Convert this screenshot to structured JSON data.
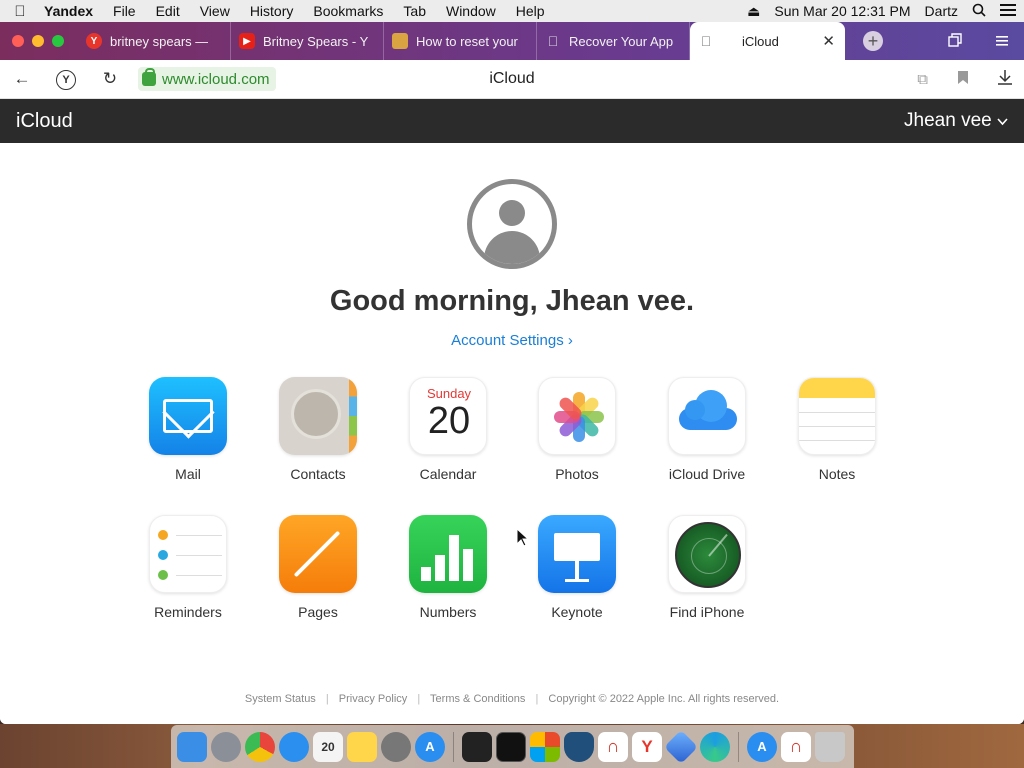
{
  "menubar": {
    "app_name": "Yandex",
    "items": [
      "File",
      "Edit",
      "View",
      "History",
      "Bookmarks",
      "Tab",
      "Window",
      "Help"
    ],
    "datetime": "Sun Mar 20  12:31 PM",
    "user": "Dartz"
  },
  "tabs": [
    {
      "label": "britney spears —",
      "icon": "yandex-icon",
      "color": "#e8352b"
    },
    {
      "label": "Britney Spears - Y",
      "icon": "youtube-icon",
      "color": "#e62117"
    },
    {
      "label": "How to reset your",
      "icon": "article-icon",
      "color": "#d9a441"
    },
    {
      "label": "Recover Your App",
      "icon": "apple-icon",
      "color": "#bbbbbb"
    },
    {
      "label": "iCloud",
      "icon": "apple-icon",
      "color": "#888888",
      "active": true
    }
  ],
  "address": {
    "url": "www.icloud.com",
    "page_title": "iCloud"
  },
  "icloud": {
    "brand": "iCloud",
    "user": "Jhean vee",
    "greeting": "Good morning, Jhean vee.",
    "account_settings": "Account Settings",
    "apps": [
      {
        "label": "Mail",
        "icon": "mail-icon"
      },
      {
        "label": "Contacts",
        "icon": "contacts-icon"
      },
      {
        "label": "Calendar",
        "icon": "calendar-icon",
        "day": "Sunday",
        "date": "20"
      },
      {
        "label": "Photos",
        "icon": "photos-icon"
      },
      {
        "label": "iCloud Drive",
        "icon": "icloud-drive-icon"
      },
      {
        "label": "Notes",
        "icon": "notes-icon"
      },
      {
        "label": "Reminders",
        "icon": "reminders-icon"
      },
      {
        "label": "Pages",
        "icon": "pages-icon"
      },
      {
        "label": "Numbers",
        "icon": "numbers-icon"
      },
      {
        "label": "Keynote",
        "icon": "keynote-icon"
      },
      {
        "label": "Find iPhone",
        "icon": "find-iphone-icon"
      }
    ],
    "footer": {
      "system_status": "System Status",
      "privacy": "Privacy Policy",
      "terms": "Terms & Conditions",
      "copyright": "Copyright © 2022 Apple Inc. All rights reserved."
    }
  },
  "dock": {
    "apps": [
      {
        "name": "finder-icon",
        "color": "#3a8ee6"
      },
      {
        "name": "launchpad-icon",
        "color": "#8a8f98"
      },
      {
        "name": "chrome-icon",
        "color": "#e8453c"
      },
      {
        "name": "safari-icon",
        "color": "#2b8ff0"
      },
      {
        "name": "calendar-icon",
        "color": "#f4f4f4"
      },
      {
        "name": "notes-icon",
        "color": "#ffd54a"
      },
      {
        "name": "system-preferences-icon",
        "color": "#777777"
      },
      {
        "name": "app-store-icon",
        "color": "#2a8ef0"
      },
      {
        "name": "activity-monitor-icon",
        "color": "#222222"
      },
      {
        "name": "terminal-icon",
        "color": "#111111"
      },
      {
        "name": "ms-office-icon",
        "color": "#e84a2a"
      },
      {
        "name": "vpn-shield-icon",
        "color": "#1f4f7a"
      },
      {
        "name": "magnet-icon",
        "color": "#d23b2f"
      },
      {
        "name": "yandex-icon",
        "color": "#ffffff"
      },
      {
        "name": "crystal-icon",
        "color": "#3a7fd8"
      },
      {
        "name": "edge-icon",
        "color": "#1b9de2"
      },
      {
        "name": "app-store-2-icon",
        "color": "#2a8ef0"
      },
      {
        "name": "magnet-2-icon",
        "color": "#d23b2f"
      },
      {
        "name": "trash-icon",
        "color": "#c8c8c8"
      }
    ]
  }
}
